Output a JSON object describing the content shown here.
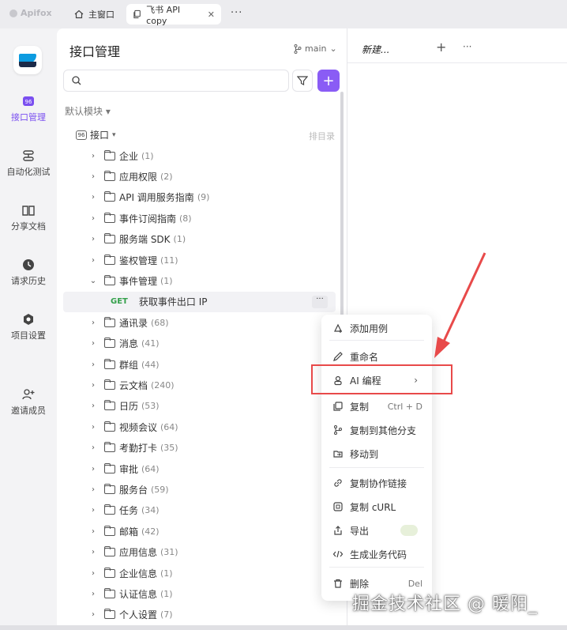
{
  "brand": "Apifox",
  "tabs": [
    {
      "label": "主窗口",
      "icon": "home-icon"
    },
    {
      "label": "飞书 API copy",
      "icon": "doc-copy-icon"
    }
  ],
  "rail": [
    {
      "label": "接口管理",
      "icon": "api-icon",
      "active": true
    },
    {
      "label": "自动化测试",
      "icon": "automation-icon"
    },
    {
      "label": "分享文档",
      "icon": "book-icon"
    },
    {
      "label": "请求历史",
      "icon": "clock-icon"
    },
    {
      "label": "项目设置",
      "icon": "settings-icon"
    },
    {
      "label": "邀请成员",
      "icon": "add-user-icon"
    }
  ],
  "panel": {
    "title": "接口管理",
    "branch": "main",
    "module": "默认模块",
    "root": "接口",
    "sort_label": "排目录"
  },
  "tree": [
    {
      "name": "企业",
      "count": "(1)"
    },
    {
      "name": "应用权限",
      "count": "(2)"
    },
    {
      "name": "API 调用服务指南",
      "count": "(9)"
    },
    {
      "name": "事件订阅指南",
      "count": "(8)"
    },
    {
      "name": "服务端 SDK",
      "count": "(1)"
    },
    {
      "name": "鉴权管理",
      "count": "(11)"
    },
    {
      "name": "事件管理",
      "count": "(1)",
      "expanded": true
    },
    {
      "method": "GET",
      "name": "获取事件出口 IP",
      "endpoint": true
    },
    {
      "name": "通讯录",
      "count": "(68)"
    },
    {
      "name": "消息",
      "count": "(41)"
    },
    {
      "name": "群组",
      "count": "(44)"
    },
    {
      "name": "云文档",
      "count": "(240)"
    },
    {
      "name": "日历",
      "count": "(53)"
    },
    {
      "name": "视频会议",
      "count": "(64)"
    },
    {
      "name": "考勤打卡",
      "count": "(35)"
    },
    {
      "name": "审批",
      "count": "(64)"
    },
    {
      "name": "服务台",
      "count": "(59)"
    },
    {
      "name": "任务",
      "count": "(34)"
    },
    {
      "name": "邮箱",
      "count": "(42)"
    },
    {
      "name": "应用信息",
      "count": "(31)"
    },
    {
      "name": "企业信息",
      "count": "(1)"
    },
    {
      "name": "认证信息",
      "count": "(1)"
    },
    {
      "name": "个人设置",
      "count": "(7)"
    }
  ],
  "right": {
    "tab_label": "新建..."
  },
  "menu": [
    {
      "label": "添加用例",
      "icon": "add-case-icon"
    },
    {
      "label": "重命名",
      "icon": "pencil-icon"
    },
    {
      "label": "AI 编程",
      "icon": "robot-icon",
      "submenu": true
    },
    {
      "label": "复制",
      "icon": "copy-icon",
      "shortcut": "Ctrl + D"
    },
    {
      "label": "复制到其他分支",
      "icon": "branch-icon"
    },
    {
      "label": "移动到",
      "icon": "move-icon"
    },
    {
      "label": "复制协作链接",
      "icon": "link-icon"
    },
    {
      "label": "复制 cURL",
      "icon": "curl-icon"
    },
    {
      "label": "导出",
      "icon": "export-icon"
    },
    {
      "label": "生成业务代码",
      "icon": "code-icon"
    },
    {
      "label": "删除",
      "icon": "trash-icon",
      "shortcut": "Del"
    }
  ],
  "watermark": "掘金技术社区 @ 暖阳_",
  "colors": {
    "accent": "#8a5cf5",
    "get": "#33a04a",
    "highlight": "#e84a4a"
  }
}
